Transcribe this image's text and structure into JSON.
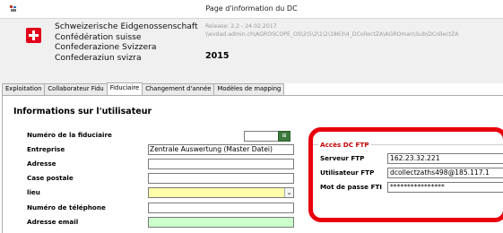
{
  "window": {
    "title": "Page d'information du DC"
  },
  "header": {
    "lines": [
      "Schweizerische Eidgenossenschaft",
      "Confédération suisse",
      "Confederazione Svizzera",
      "Confederaziun svizra"
    ],
    "release": "Release: 2.2  -  24.02.2017",
    "path": "\\\\evdad.admin.ch\\AGROSCOPE_OS\\2\\5\\2\\1\\2\\1863\\4_DCollectZA\\AGROman\\Sub\\DCollectZA",
    "year": "2015"
  },
  "tabs": [
    {
      "label": "Exploitation",
      "active": false
    },
    {
      "label": "Collaborateur Fidu",
      "active": false
    },
    {
      "label": "Fiduciaire",
      "active": true
    },
    {
      "label": "Changement d'année",
      "active": false
    },
    {
      "label": "Modèles de mapping",
      "active": false
    }
  ],
  "user_info": {
    "title": "Informations sur l'utilisateur",
    "numero_fiduciaire_label": "Numéro de la fiduciaire",
    "entreprise_label": "Entreprise",
    "entreprise_value": "Zentrale Auswertung (Master Datei)",
    "adresse_label": "Adresse",
    "case_postale_label": "Case postale",
    "lieu_label": "lieu",
    "telephone_label": "Numéro de téléphone",
    "email_label": "Adresse email"
  },
  "ftp": {
    "legend": "Accès DC FTP",
    "serveur_label": "Serveur FTP",
    "serveur_value": "162.23.32.221",
    "utilisateur_label": "Utilisateur FTP",
    "utilisateur_value": "dcollectzaths498@185.117.1",
    "password_label": "Mot de passe FTI",
    "password_value": "****************"
  },
  "colors": {
    "highlight": "#e8000b",
    "lieu_field": "#ffffaa",
    "email_field": "#ccffcc",
    "legend": "#c00000"
  }
}
